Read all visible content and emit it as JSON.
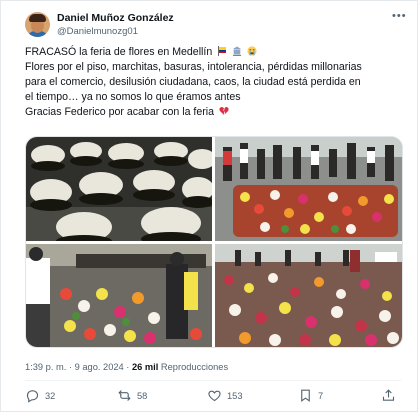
{
  "author": {
    "name": "Daniel Muñoz González",
    "handle": "@Danielmunozg01"
  },
  "tweet": {
    "line1": "FRACASÓ la feria de flores en Medellín",
    "line2": "Flores por el piso, marchitas, basuras, intolerancia, pérdidas millonarias",
    "line3": "para el comercio, desilusión ciudadana, caos, la ciudad está perdida en",
    "line4": "el tiempo… ya no somos lo que éramos antes",
    "line5": "Gracias Federico por acabar con la feria"
  },
  "meta": {
    "time": "1:39 p. m. · 9 ago. 2024 · ",
    "views_count": "26 mil",
    "views_label": " Reproducciones"
  },
  "actions": {
    "replies": "32",
    "retweets": "58",
    "likes": "153",
    "bookmarks": "7"
  },
  "icons": [
    "more-icon",
    "colombia-flag-icon",
    "building-icon",
    "crying-face-icon",
    "broken-heart-icon",
    "reply-icon",
    "retweet-icon",
    "like-icon",
    "bookmark-icon",
    "share-icon"
  ],
  "colors": {
    "text": "#0f1419",
    "secondary": "#536471",
    "broken_heart": "#f91880"
  }
}
